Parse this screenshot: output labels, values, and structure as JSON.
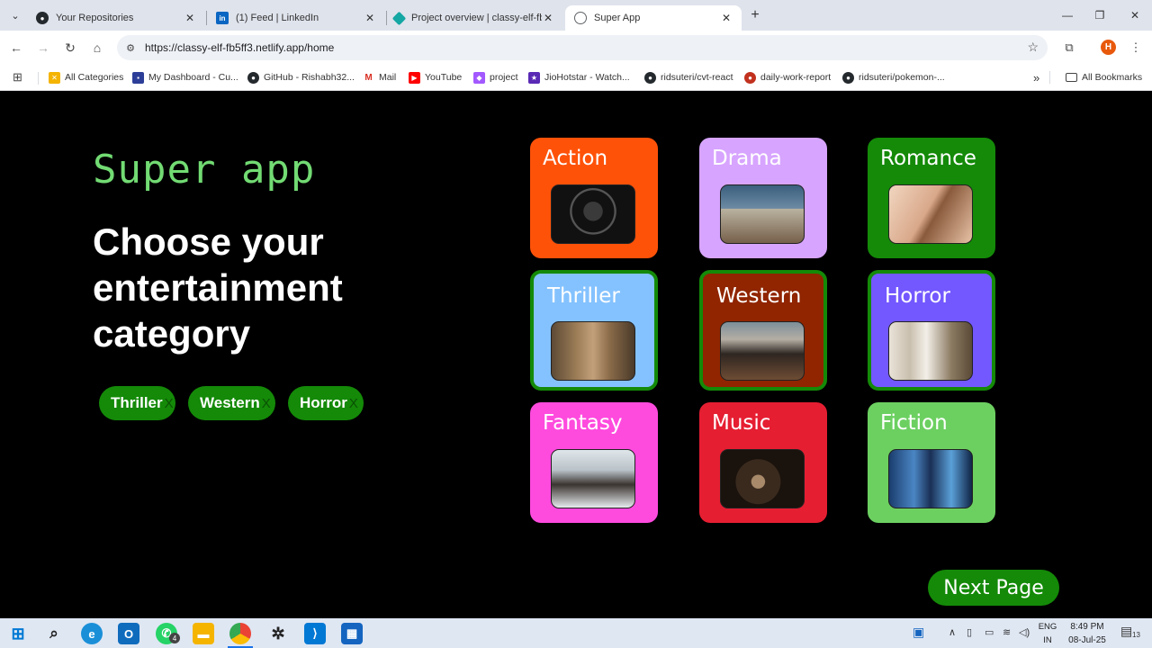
{
  "browser": {
    "tabs": [
      {
        "title": "Your Repositories",
        "icon": "github-icon",
        "active": false
      },
      {
        "title": "(1) Feed | LinkedIn",
        "icon": "linkedin-icon",
        "active": false
      },
      {
        "title": "Project overview | classy-elf-fb5",
        "icon": "netlify-icon",
        "active": false
      },
      {
        "title": "Super App",
        "icon": "globe-icon",
        "active": true
      }
    ],
    "url": "https://classy-elf-fb5ff3.netlify.app/home",
    "profile_initial": "H",
    "bookmarks": [
      {
        "label": "All Categories"
      },
      {
        "label": "My Dashboard - Cu..."
      },
      {
        "label": "GitHub - Rishabh32..."
      },
      {
        "label": "Mail"
      },
      {
        "label": "YouTube"
      },
      {
        "label": "project"
      },
      {
        "label": "JioHotstar - Watch..."
      },
      {
        "label": "ridsuteri/cvt-react"
      },
      {
        "label": "daily-work-report"
      },
      {
        "label": "ridsuteri/pokemon-..."
      }
    ],
    "bookmarks_overflow": "»",
    "all_bookmarks": "All Bookmarks"
  },
  "page": {
    "brand": "Super app",
    "heading": "Choose your entertainment category",
    "selected_chips": [
      {
        "label": "Thriller",
        "remove": "X"
      },
      {
        "label": "Western",
        "remove": "X"
      },
      {
        "label": "Horror",
        "remove": "X"
      }
    ],
    "categories": [
      {
        "label": "Action",
        "color": "#ff5209",
        "selected": false
      },
      {
        "label": "Drama",
        "color": "#d7a4ff",
        "selected": false
      },
      {
        "label": "Romance",
        "color": "#148a08",
        "selected": false
      },
      {
        "label": "Thriller",
        "color": "#84c2ff",
        "selected": true
      },
      {
        "label": "Western",
        "color": "#902500",
        "selected": true
      },
      {
        "label": "Horror",
        "color": "#7358ff",
        "selected": true
      },
      {
        "label": "Fantasy",
        "color": "#ff4ade",
        "selected": false
      },
      {
        "label": "Music",
        "color": "#e61e32",
        "selected": false
      },
      {
        "label": "Fiction",
        "color": "#6cd061",
        "selected": false
      }
    ],
    "next_button": "Next Page",
    "accent_color": "#148a08"
  },
  "taskbar": {
    "lang_top": "ENG",
    "lang_bottom": "IN",
    "time": "8:49 PM",
    "date": "08-Jul-25",
    "notification_count": "13",
    "whatsapp_badge": "4"
  }
}
